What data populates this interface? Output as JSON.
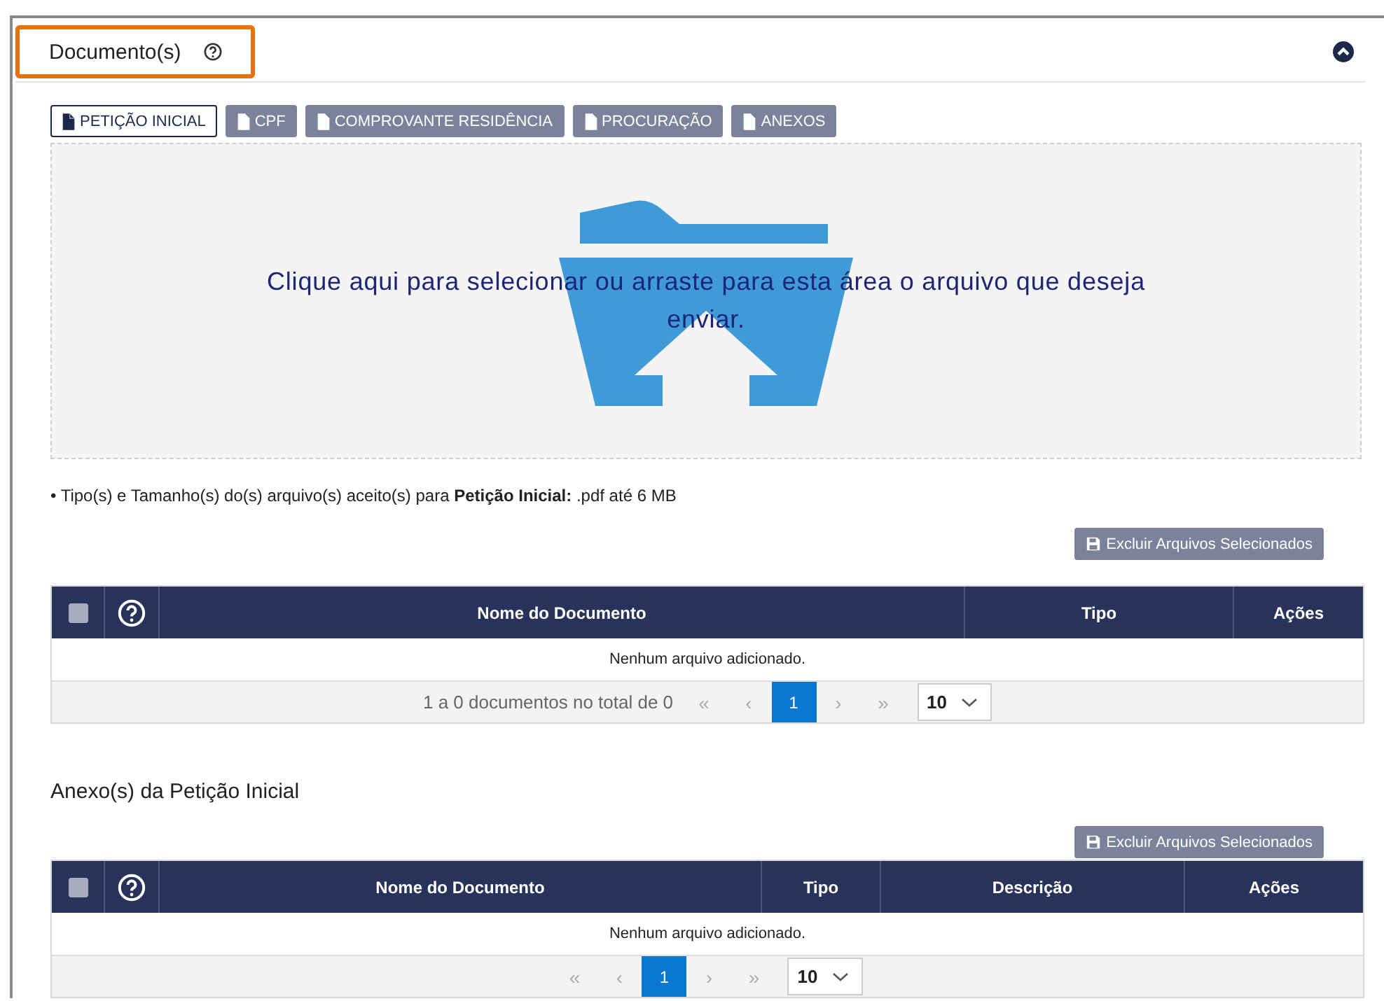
{
  "section": {
    "title": "Documento(s)",
    "highlighted": true,
    "expanded": true
  },
  "doc_tabs": [
    {
      "label": "PETIÇÃO INICIAL",
      "selected": true
    },
    {
      "label": "CPF",
      "selected": false
    },
    {
      "label": "COMPROVANTE RESIDÊNCIA",
      "selected": false
    },
    {
      "label": "PROCURAÇÃO",
      "selected": false
    },
    {
      "label": "ANEXOS",
      "selected": false
    }
  ],
  "dropzone": {
    "text": "Clique aqui para selecionar ou arraste para esta área o arquivo que deseja enviar."
  },
  "accepted_note": "• Tipo(s) e Tamanho(s) do(s) arquivo(s) aceito(s) para **Petição Inicial:** .pdf até 6 MB",
  "tables": [
    {
      "delete_button": "Excluir Arquivos Selecionados",
      "columns": [
        {
          "kind": "checkbox",
          "checked": false
        },
        {
          "kind": "help"
        },
        {
          "kind": "text",
          "label": "Nome do Documento"
        },
        {
          "kind": "text",
          "label": "Tipo"
        },
        {
          "kind": "text",
          "label": "Ações"
        }
      ],
      "empty_message": "Nenhum arquivo adicionado.",
      "pagination": {
        "summary": "1 a 0 documentos no total de 0",
        "first": "«",
        "prev": "‹",
        "pages": [
          {
            "label": "1",
            "selected": true
          }
        ],
        "next": "›",
        "last": "»",
        "page_size": "10"
      }
    },
    {
      "title": "Anexo(s) da Petição Inicial",
      "delete_button": "Excluir Arquivos Selecionados",
      "columns": [
        {
          "kind": "checkbox",
          "checked": false
        },
        {
          "kind": "help"
        },
        {
          "kind": "text",
          "label": "Nome do Documento"
        },
        {
          "kind": "text",
          "label": "Tipo"
        },
        {
          "kind": "text",
          "label": "Descrição"
        },
        {
          "kind": "text",
          "label": "Ações"
        }
      ],
      "empty_message": "Nenhum arquivo adicionado.",
      "pagination": {
        "first": "«",
        "prev": "‹",
        "pages": [
          {
            "label": "1",
            "selected": true
          }
        ],
        "next": "›",
        "last": "»",
        "page_size": "10"
      }
    }
  ]
}
